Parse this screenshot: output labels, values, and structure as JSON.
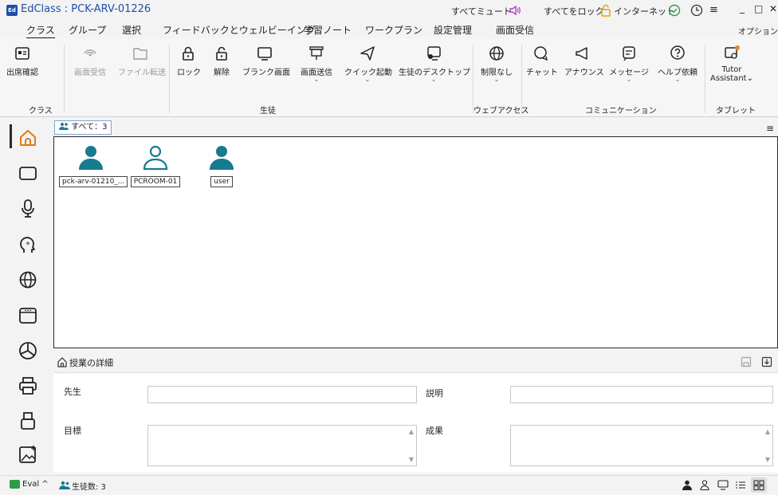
{
  "window": {
    "title": "EdClass : PCK-ARV-01226",
    "app_icon_text": "Ed",
    "mute_all": "すべてミュート",
    "lock_all": "すべてをロック",
    "internet": "インターネット",
    "minimize": "_",
    "restore": "□",
    "close": "✕"
  },
  "menu": {
    "items": [
      "クラス",
      "グループ",
      "選択",
      "フィードバックとウェルビーイング",
      "学習ノート",
      "ワークプラン",
      "設定管理",
      "画面受信"
    ],
    "options": "オプション"
  },
  "ribbon": {
    "groups": {
      "class": "クラス",
      "students": "生徒",
      "web_access": "ウェブアクセス",
      "communication": "コミュニケーション",
      "tablet": "タブレット"
    },
    "buttons": {
      "attendance": "出席確認",
      "screen_receive": "画面受信",
      "file_transfer": "ファイル転送",
      "lock": "ロック",
      "unlock": "解除",
      "blank_screen": "ブランク画面",
      "screen_send": "画面送信",
      "quick_launch": "クイック起動",
      "student_desktop": "生徒のデスクトップ",
      "no_restriction": "制限なし",
      "chat": "チャット",
      "announce": "アナウンス",
      "message": "メッセージ",
      "help_request": "ヘルプ依頼",
      "tutor_assistant_1": "Tutor",
      "tutor_assistant_2": "Assistant"
    }
  },
  "view_tab": "すべて：3",
  "students": [
    {
      "name": "pck-arv-01210_...",
      "style": "filled"
    },
    {
      "name": "PCROOM-01",
      "style": "outline"
    },
    {
      "name": "user",
      "style": "filled"
    }
  ],
  "details": {
    "title": "授業の詳細",
    "teacher_label": "先生",
    "teacher_value": "",
    "description_label": "説明",
    "description_value": "",
    "goal_label": "目標",
    "goal_value": "",
    "outcome_label": "成果",
    "outcome_value": ""
  },
  "status": {
    "eval": "Eval",
    "student_count": "生徒数: 3"
  },
  "colors": {
    "accent": "#1d4fa8",
    "student_teal": "#177a8e",
    "speaker_purple": "#b23bd6",
    "lock_yellow": "#e2a800",
    "ok_green": "#2e9b4b",
    "tablet_badge": "#f08020"
  }
}
